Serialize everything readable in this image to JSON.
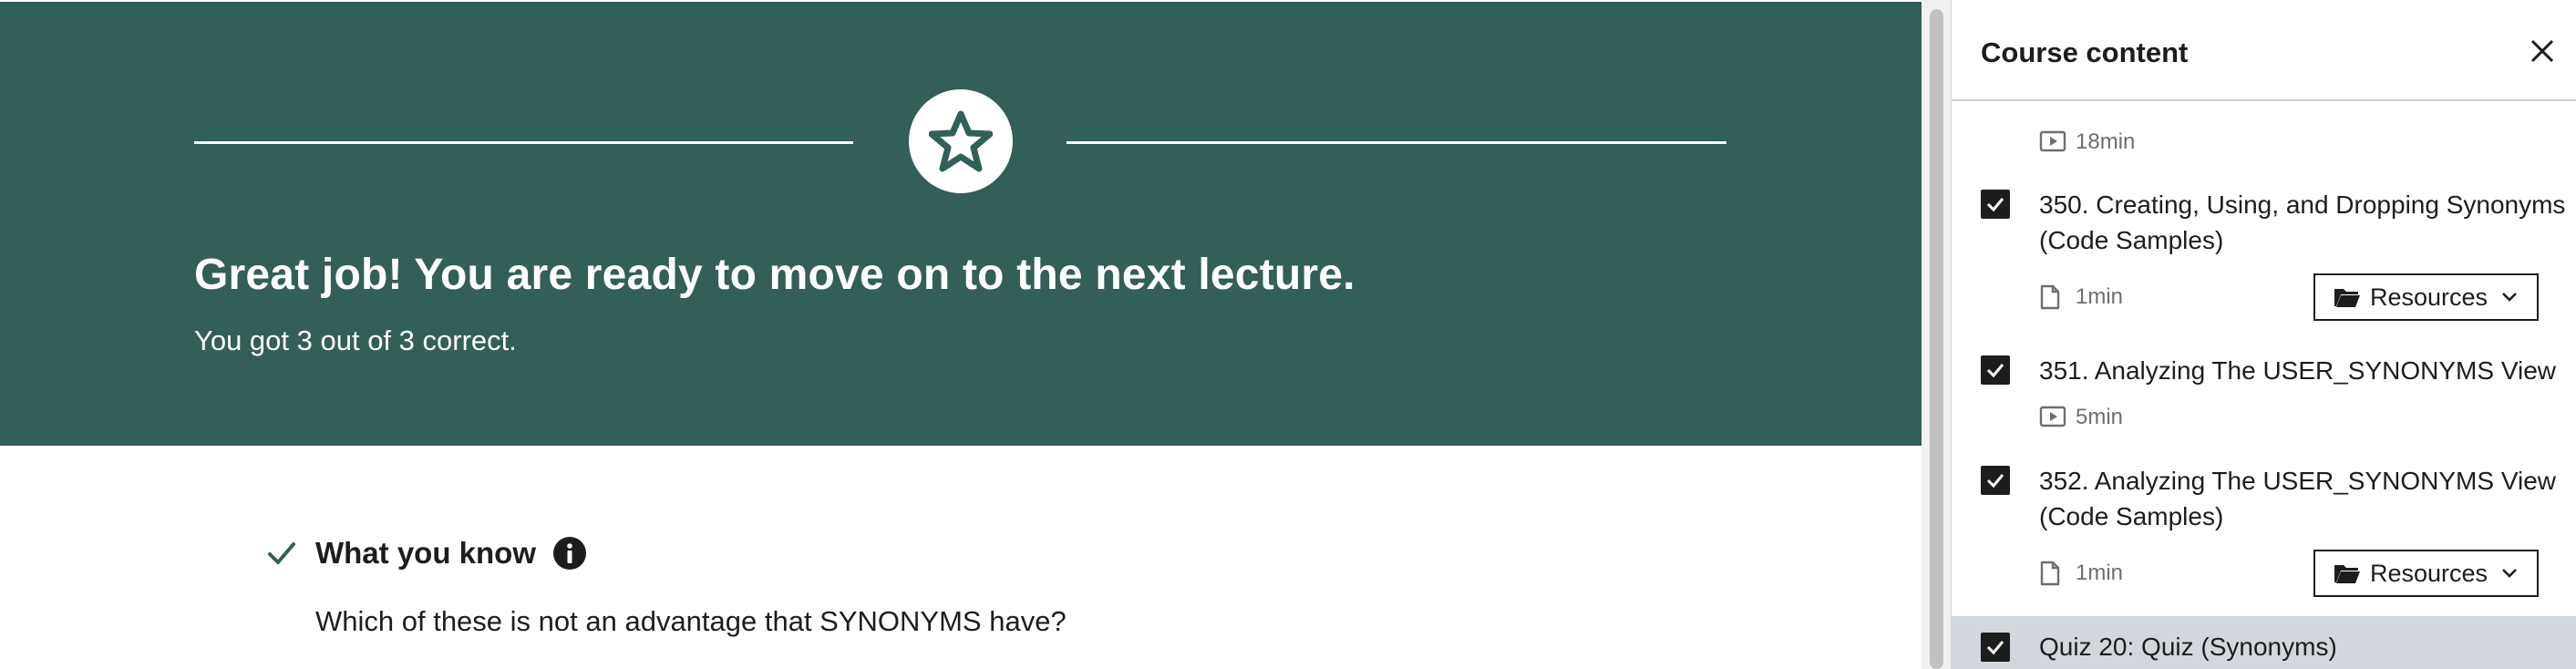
{
  "banner": {
    "title": "Great job! You are ready to move on to the next lecture.",
    "subtitle": "You got 3 out of 3 correct.",
    "icon": "star-icon",
    "background_color": "#325f57"
  },
  "knowledge": {
    "title": "What you know",
    "question": "Which of these is not an advantage that SYNONYMS have?"
  },
  "sidebar": {
    "title": "Course content",
    "partial_item": {
      "duration": "18min"
    },
    "items": [
      {
        "title": "350. Creating, Using, and Dropping Synonyms (Code Samples)",
        "type": "article",
        "duration": "1min",
        "resources_label": "Resources",
        "checked": true
      },
      {
        "title": "351. Analyzing The USER_SYNONYMS View",
        "type": "video",
        "duration": "5min",
        "checked": true
      },
      {
        "title": "352. Analyzing The USER_SYNONYMS View (Code Samples)",
        "type": "article",
        "duration": "1min",
        "resources_label": "Resources",
        "checked": true
      },
      {
        "title": "Quiz 20: Quiz (Synonyms)",
        "type": "quiz",
        "checked": true,
        "active": true
      }
    ]
  },
  "colors": {
    "accent_dark": "#1c1d1f",
    "muted_text": "#6a6f73",
    "active_row": "#d1d7dc"
  }
}
